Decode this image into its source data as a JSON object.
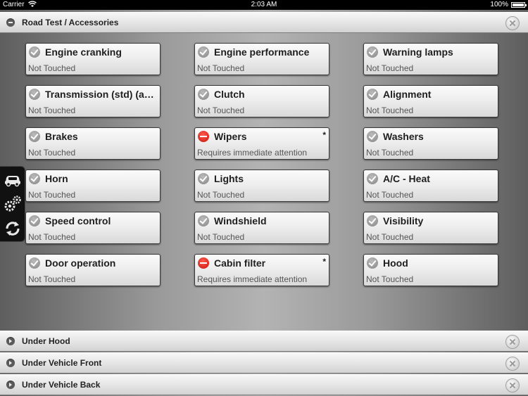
{
  "status_bar": {
    "carrier": "Carrier",
    "time": "2:03 AM",
    "battery": "100%"
  },
  "sections": {
    "road_test": {
      "title": "Road Test / Accessories"
    },
    "under_hood": {
      "title": "Under Hood"
    },
    "under_vehicle_front": {
      "title": "Under Vehicle Front"
    },
    "under_vehicle_back": {
      "title": "Under Vehicle Back"
    }
  },
  "items": [
    {
      "name": "Engine cranking",
      "state": "Not Touched",
      "status": "check",
      "flag": ""
    },
    {
      "name": "Engine performance",
      "state": "Not Touched",
      "status": "check",
      "flag": ""
    },
    {
      "name": "Warning lamps",
      "state": "Not Touched",
      "status": "check",
      "flag": ""
    },
    {
      "name": "Transmission (std) (a…",
      "state": "Not Touched",
      "status": "check",
      "flag": ""
    },
    {
      "name": "Clutch",
      "state": "Not Touched",
      "status": "check",
      "flag": ""
    },
    {
      "name": "Alignment",
      "state": "Not Touched",
      "status": "check",
      "flag": ""
    },
    {
      "name": "Brakes",
      "state": "Not Touched",
      "status": "check",
      "flag": ""
    },
    {
      "name": "Wipers",
      "state": "Requires immediate attention",
      "status": "stop",
      "flag": "*"
    },
    {
      "name": "Washers",
      "state": "Not Touched",
      "status": "check",
      "flag": ""
    },
    {
      "name": "Horn",
      "state": "Not Touched",
      "status": "check",
      "flag": ""
    },
    {
      "name": "Lights",
      "state": "Not Touched",
      "status": "check",
      "flag": ""
    },
    {
      "name": "A/C - Heat",
      "state": "Not Touched",
      "status": "check",
      "flag": ""
    },
    {
      "name": "Speed control",
      "state": "Not Touched",
      "status": "check",
      "flag": ""
    },
    {
      "name": "Windshield",
      "state": "Not Touched",
      "status": "check",
      "flag": ""
    },
    {
      "name": "Visibility",
      "state": "Not Touched",
      "status": "check",
      "flag": ""
    },
    {
      "name": "Door operation",
      "state": "Not Touched",
      "status": "check",
      "flag": ""
    },
    {
      "name": "Cabin filter",
      "state": "Requires immediate attention",
      "status": "stop",
      "flag": "*"
    },
    {
      "name": "Hood",
      "state": "Not Touched",
      "status": "check",
      "flag": ""
    }
  ],
  "toolbar": {
    "icons": [
      "car-icon",
      "gears-icon",
      "refresh-icon"
    ]
  }
}
